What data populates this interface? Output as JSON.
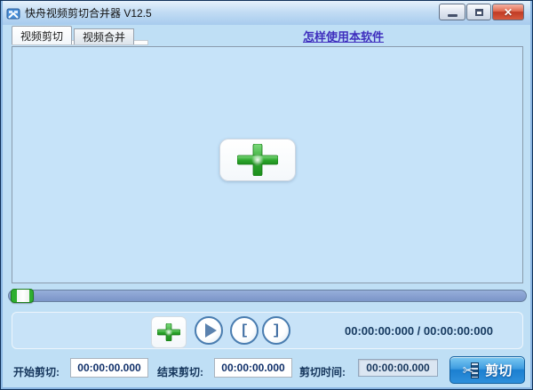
{
  "window": {
    "title": "快舟视频剪切合并器 V12.5"
  },
  "tabs": {
    "cut": "视频剪切",
    "merge": "视频合并"
  },
  "help_link": {
    "label": "怎样使用本软件"
  },
  "player": {
    "time_display": "00:00:00:000 / 00:00:00:000"
  },
  "cut_form": {
    "start_label": "开始剪切:",
    "start_value": "00:00:00.000",
    "end_label": "结束剪切:",
    "end_value": "00:00:00.000",
    "duration_label": "剪切时间:",
    "duration_value": "00:00:00.000",
    "cut_button_label": "剪切"
  },
  "icons": {
    "close_glyph": "✕",
    "scissors_glyph": "✂"
  },
  "colors": {
    "window_bg": "#bfdff5",
    "titlebar_top": "#e5f1fb",
    "video_area_bg": "#c6e3f9",
    "slider_track": "#7e99cb",
    "accent_green": "#2eae2e",
    "cut_button_blue": "#2a8ad8",
    "navy_text": "#16365c",
    "link_color": "#3f2fbe",
    "close_red": "#c8452f"
  }
}
